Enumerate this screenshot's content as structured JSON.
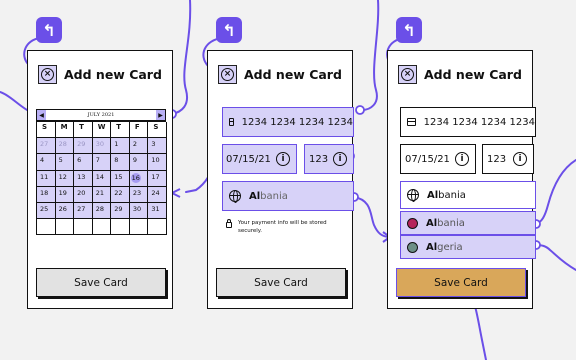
{
  "screens": [
    {
      "back_icon": "back-arrow-icon",
      "close_icon": "close-circle-icon",
      "title": "Add new Card",
      "calendar": {
        "month_label": "JULY 2021",
        "weekdays": [
          "S",
          "M",
          "T",
          "W",
          "T",
          "F",
          "S"
        ],
        "weeks": [
          [
            "27",
            "28",
            "29",
            "30",
            "1",
            "2",
            "3"
          ],
          [
            "4",
            "5",
            "6",
            "7",
            "8",
            "9",
            "10"
          ],
          [
            "11",
            "12",
            "13",
            "14",
            "15",
            "16",
            "17"
          ],
          [
            "18",
            "19",
            "20",
            "21",
            "22",
            "23",
            "24"
          ],
          [
            "25",
            "26",
            "27",
            "28",
            "29",
            "30",
            "31"
          ],
          [
            "",
            "",
            "",
            "",
            "",
            "",
            ""
          ]
        ],
        "highlighted_day": "16"
      },
      "save_label": "Save Card"
    },
    {
      "back_icon": "back-arrow-icon",
      "close_icon": "close-circle-icon",
      "title": "Add new Card",
      "card_number": "1234 1234 1234 1234",
      "expiry": "07/15/21",
      "cvv": "123",
      "country": {
        "typed": "Al",
        "rest": "bania"
      },
      "security_note": "Your payment info will be stored securely.",
      "save_label": "Save Card"
    },
    {
      "back_icon": "back-arrow-icon",
      "close_icon": "close-circle-icon",
      "title": "Add new Card",
      "card_number": "1234 1234 1234 1234",
      "expiry": "07/15/21",
      "cvv": "123",
      "country": {
        "typed": "Al",
        "rest": "bania"
      },
      "suggestions": [
        {
          "typed": "Al",
          "rest": "bania",
          "color": "#b5245b"
        },
        {
          "typed": "Al",
          "rest": "geria",
          "color": "#6d8f86"
        }
      ],
      "save_label": "Save Card"
    }
  ],
  "colors": {
    "accent": "#6b4fe8",
    "highlight": "#d7d2f8",
    "save_active": "#d9a75a",
    "save_default": "#e2e2e2"
  }
}
